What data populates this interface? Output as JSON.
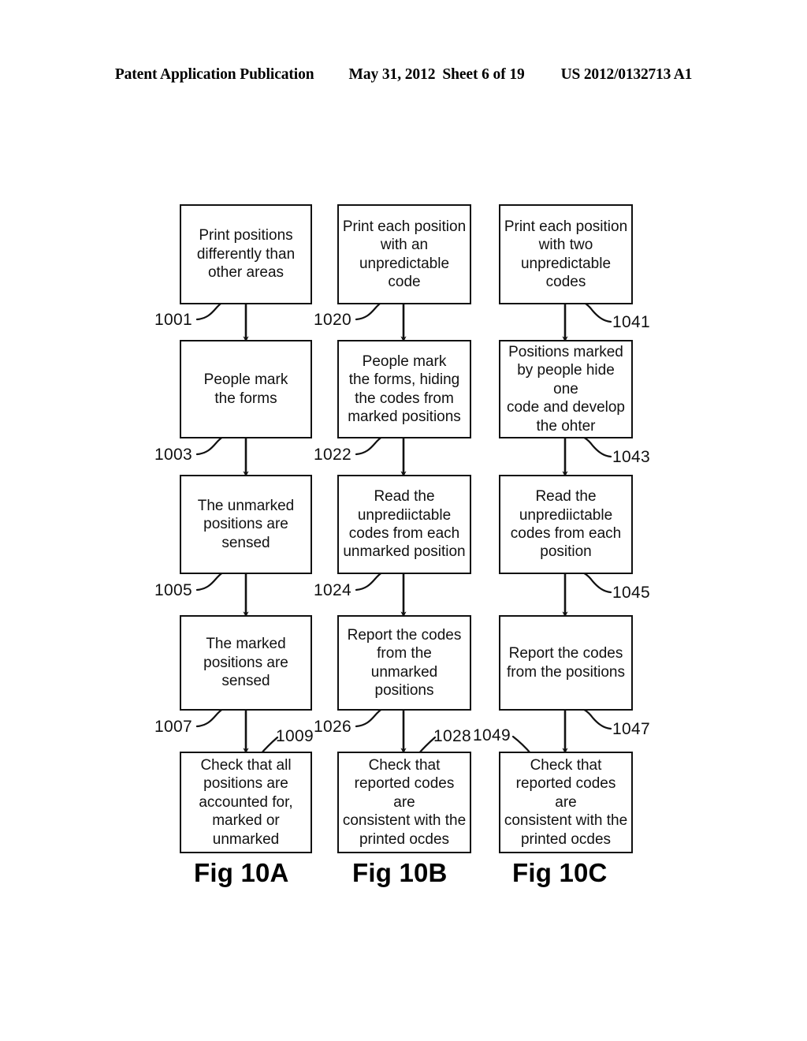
{
  "header": {
    "publication": "Patent Application Publication",
    "date": "May 31, 2012",
    "sheet": "Sheet 6 of 19",
    "patent_number": "US 2012/0132713 A1"
  },
  "figures": [
    {
      "caption": "Fig 10A",
      "steps": [
        {
          "ref": "1001",
          "text": "Print positions\ndifferently than\nother areas"
        },
        {
          "ref": "1003",
          "text": "People mark\nthe forms"
        },
        {
          "ref": "1005",
          "text": "The unmarked\npositions are\nsensed"
        },
        {
          "ref": "1007",
          "text": "The marked\npositions are\nsensed"
        },
        {
          "ref": "1009",
          "text": "Check that all\npositions are\naccounted for,\nmarked or\nunmarked"
        }
      ]
    },
    {
      "caption": "Fig 10B",
      "steps": [
        {
          "ref": "1020",
          "text": "Print each position\nwith an\nunpredictable\ncode"
        },
        {
          "ref": "1022",
          "text": "People mark\nthe forms, hiding\nthe codes from\nmarked positions"
        },
        {
          "ref": "1024",
          "text": "Read the\nunprediictable\ncodes from each\nunmarked position"
        },
        {
          "ref": "1026",
          "text": "Report the codes\nfrom the unmarked\npositions"
        },
        {
          "ref": "1028",
          "text": "Check that\nreported codes are\nconsistent with the\nprinted ocdes"
        }
      ]
    },
    {
      "caption": "Fig 10C",
      "steps": [
        {
          "ref": "1041",
          "text": "Print each position\nwith two\nunpredictable\ncodes"
        },
        {
          "ref": "1043",
          "text": "Positions marked\nby people hide one\ncode and develop\nthe ohter"
        },
        {
          "ref": "1045",
          "text": "Read the\nunprediictable\ncodes from each\nposition"
        },
        {
          "ref": "1047",
          "text": "Report the codes\nfrom the positions"
        },
        {
          "ref": "1049",
          "text": "Check that\nreported codes are\nconsistent with the\nprinted ocdes"
        }
      ]
    }
  ],
  "style": {
    "ink": "#111111",
    "paper": "#ffffff"
  }
}
